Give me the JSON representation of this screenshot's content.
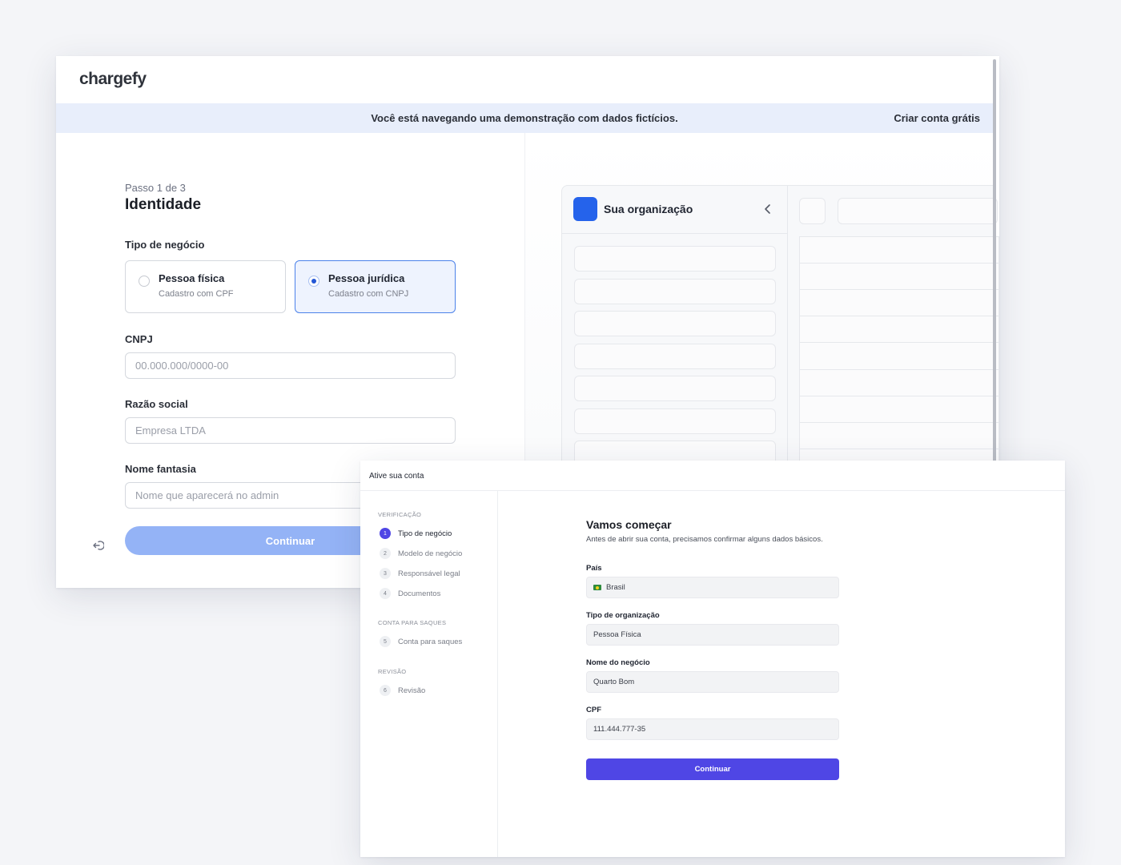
{
  "back_window": {
    "logo": "chargefy",
    "banner": {
      "message": "Você está navegando uma demonstração com dados fictícios.",
      "cta": "Criar conta grátis"
    },
    "form": {
      "step": "Passo 1 de 3",
      "title": "Identidade",
      "business_type_label": "Tipo de negócio",
      "options": [
        {
          "title": "Pessoa física",
          "subtitle": "Cadastro com CPF",
          "selected": false
        },
        {
          "title": "Pessoa jurídica",
          "subtitle": "Cadastro com CNPJ",
          "selected": true
        }
      ],
      "cnpj_label": "CNPJ",
      "cnpj_placeholder": "00.000.000/0000-00",
      "razao_label": "Razão social",
      "razao_placeholder": "Empresa LTDA",
      "fantasia_label": "Nome fantasia",
      "fantasia_placeholder": "Nome que aparecerá no admin",
      "continue_label": "Continuar"
    },
    "preview": {
      "org_name": "Sua organização",
      "accent": "#2563eb"
    }
  },
  "front_window": {
    "title": "Ative sua conta",
    "nav": {
      "sections": [
        {
          "label": "VERIFICAÇÃO",
          "items": [
            {
              "num": "1",
              "label": "Tipo de negócio",
              "active": true
            },
            {
              "num": "2",
              "label": "Modelo de negócio",
              "active": false
            },
            {
              "num": "3",
              "label": "Responsável legal",
              "active": false
            },
            {
              "num": "4",
              "label": "Documentos",
              "active": false
            }
          ]
        },
        {
          "label": "CONTA PARA SAQUES",
          "items": [
            {
              "num": "5",
              "label": "Conta para saques",
              "active": false
            }
          ]
        },
        {
          "label": "REVISÃO",
          "items": [
            {
              "num": "6",
              "label": "Revisão",
              "active": false
            }
          ]
        }
      ]
    },
    "content": {
      "title": "Vamos começar",
      "subtitle": "Antes de abrir sua conta, precisamos confirmar alguns dados básicos.",
      "country_label": "País",
      "country_value": "Brasil",
      "org_type_label": "Tipo de organização",
      "org_type_value": "Pessoa Física",
      "business_name_label": "Nome do negócio",
      "business_name_value": "Quarto Bom",
      "cpf_label": "CPF",
      "cpf_value": "111.444.777-35",
      "continue_label": "Continuar",
      "accent": "#4f46e5"
    }
  }
}
